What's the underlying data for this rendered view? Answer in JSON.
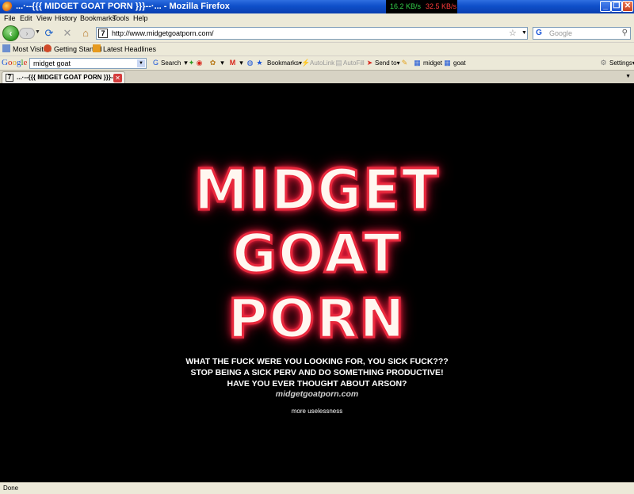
{
  "window": {
    "title": "...·--{{{ MIDGET GOAT PORN }}}--·... - Mozilla Firefox",
    "net_down": "16.2 KB/s",
    "net_up": "32.5 KB/s"
  },
  "menu": [
    "File",
    "Edit",
    "View",
    "History",
    "Bookmarks",
    "Tools",
    "Help"
  ],
  "nav": {
    "url": "http://www.midgetgoatporn.com/",
    "search_placeholder": "Google"
  },
  "bookmarks": [
    "Most Visited",
    "Getting Started",
    "Latest Headlines"
  ],
  "google_toolbar": {
    "logo": "Google",
    "search_value": "midget goat",
    "search_label": "Search",
    "bookmarks_label": "Bookmarks",
    "autolink_label": "AutoLink",
    "autofill_label": "AutoFill",
    "sendto_label": "Send to",
    "term1": "midget",
    "term2": "goat",
    "settings_label": "Settings"
  },
  "tab": {
    "label": "...·--{{{ MIDGET GOAT PORN }}}--·..."
  },
  "page": {
    "neon_line1": "MIDGET",
    "neon_line2": "GOAT",
    "neon_line3": "PORN",
    "message1": "WHAT THE FUCK WERE YOU LOOKING FOR, YOU SICK FUCK???",
    "message2": "STOP BEING A SICK PERV AND DO SOMETHING PRODUCTIVE!",
    "message3": "HAVE YOU EVER THOUGHT ABOUT ARSON?",
    "site": "midgetgoatporn.com",
    "more_link": "more uselessness"
  },
  "status": "Done"
}
